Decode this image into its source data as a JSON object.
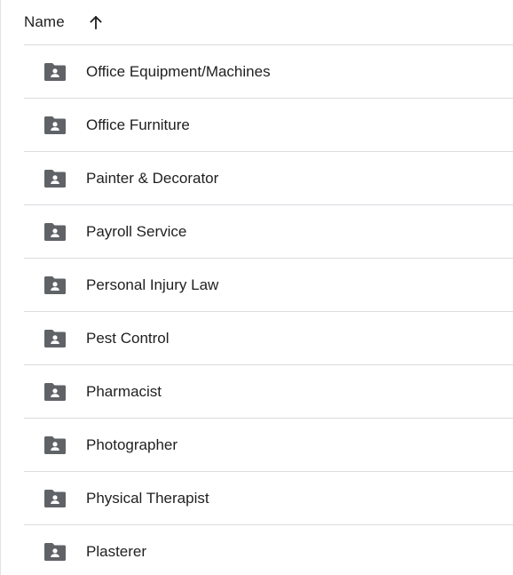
{
  "header": {
    "name_label": "Name",
    "sort_icon": "arrow-up-icon"
  },
  "folders": [
    {
      "label": "Office Equipment/Machines",
      "icon": "shared-folder-icon"
    },
    {
      "label": "Office Furniture",
      "icon": "shared-folder-icon"
    },
    {
      "label": "Painter & Decorator",
      "icon": "shared-folder-icon"
    },
    {
      "label": "Payroll Service",
      "icon": "shared-folder-icon"
    },
    {
      "label": "Personal Injury Law",
      "icon": "shared-folder-icon"
    },
    {
      "label": "Pest Control",
      "icon": "shared-folder-icon"
    },
    {
      "label": "Pharmacist",
      "icon": "shared-folder-icon"
    },
    {
      "label": "Photographer",
      "icon": "shared-folder-icon"
    },
    {
      "label": "Physical Therapist",
      "icon": "shared-folder-icon"
    },
    {
      "label": "Plasterer",
      "icon": "shared-folder-icon"
    }
  ],
  "colors": {
    "icon": "#5f6368",
    "divider": "#dadce0",
    "text": "#1f1f1f"
  }
}
